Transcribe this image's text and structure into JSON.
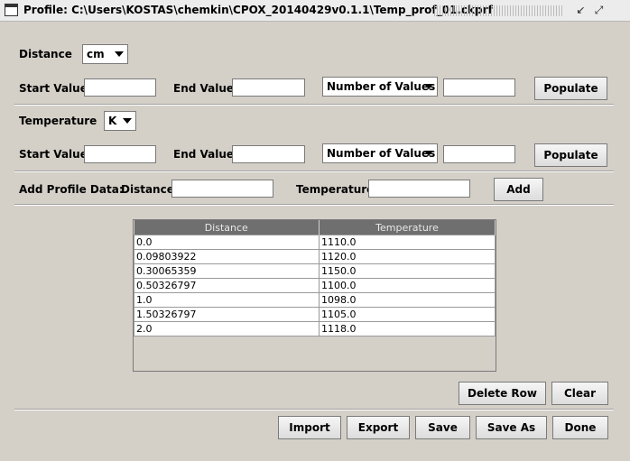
{
  "window": {
    "title": "Profile:  C:\\Users\\KOSTAS\\chemkin\\CPOX_20140429v0.1.1\\Temp_prof_01.ckprf"
  },
  "distance_section": {
    "label": "Distance",
    "unit": "cm",
    "start_label": "Start Value:",
    "start_value": "",
    "end_label": "End Value:",
    "end_value": "",
    "mode": "Number of Values",
    "mode_value": "",
    "populate_label": "Populate"
  },
  "temperature_section": {
    "label": "Temperature",
    "unit": "K",
    "start_label": "Start Value:",
    "start_value": "",
    "end_label": "End Value:",
    "end_value": "",
    "mode": "Number of Values",
    "mode_value": "",
    "populate_label": "Populate"
  },
  "add_profile": {
    "label": "Add Profile Data:",
    "distance_label": "Distance",
    "distance_value": "",
    "temperature_label": "Temperature",
    "temperature_value": "",
    "add_label": "Add"
  },
  "table": {
    "headers": [
      "Distance",
      "Temperature"
    ],
    "rows": [
      [
        "0.0",
        "1110.0"
      ],
      [
        "0.09803922",
        "1120.0"
      ],
      [
        "0.30065359",
        "1150.0"
      ],
      [
        "0.50326797",
        "1100.0"
      ],
      [
        "1.0",
        "1098.0"
      ],
      [
        "1.50326797",
        "1105.0"
      ],
      [
        "2.0",
        "1118.0"
      ]
    ]
  },
  "table_actions": {
    "delete_row": "Delete Row",
    "clear": "Clear"
  },
  "footer": {
    "import": "Import",
    "export": "Export",
    "save": "Save",
    "save_as": "Save As",
    "done": "Done"
  },
  "icons": {
    "window": "window-icon",
    "restore": "restore-icon",
    "maximize": "maximize-icon"
  }
}
